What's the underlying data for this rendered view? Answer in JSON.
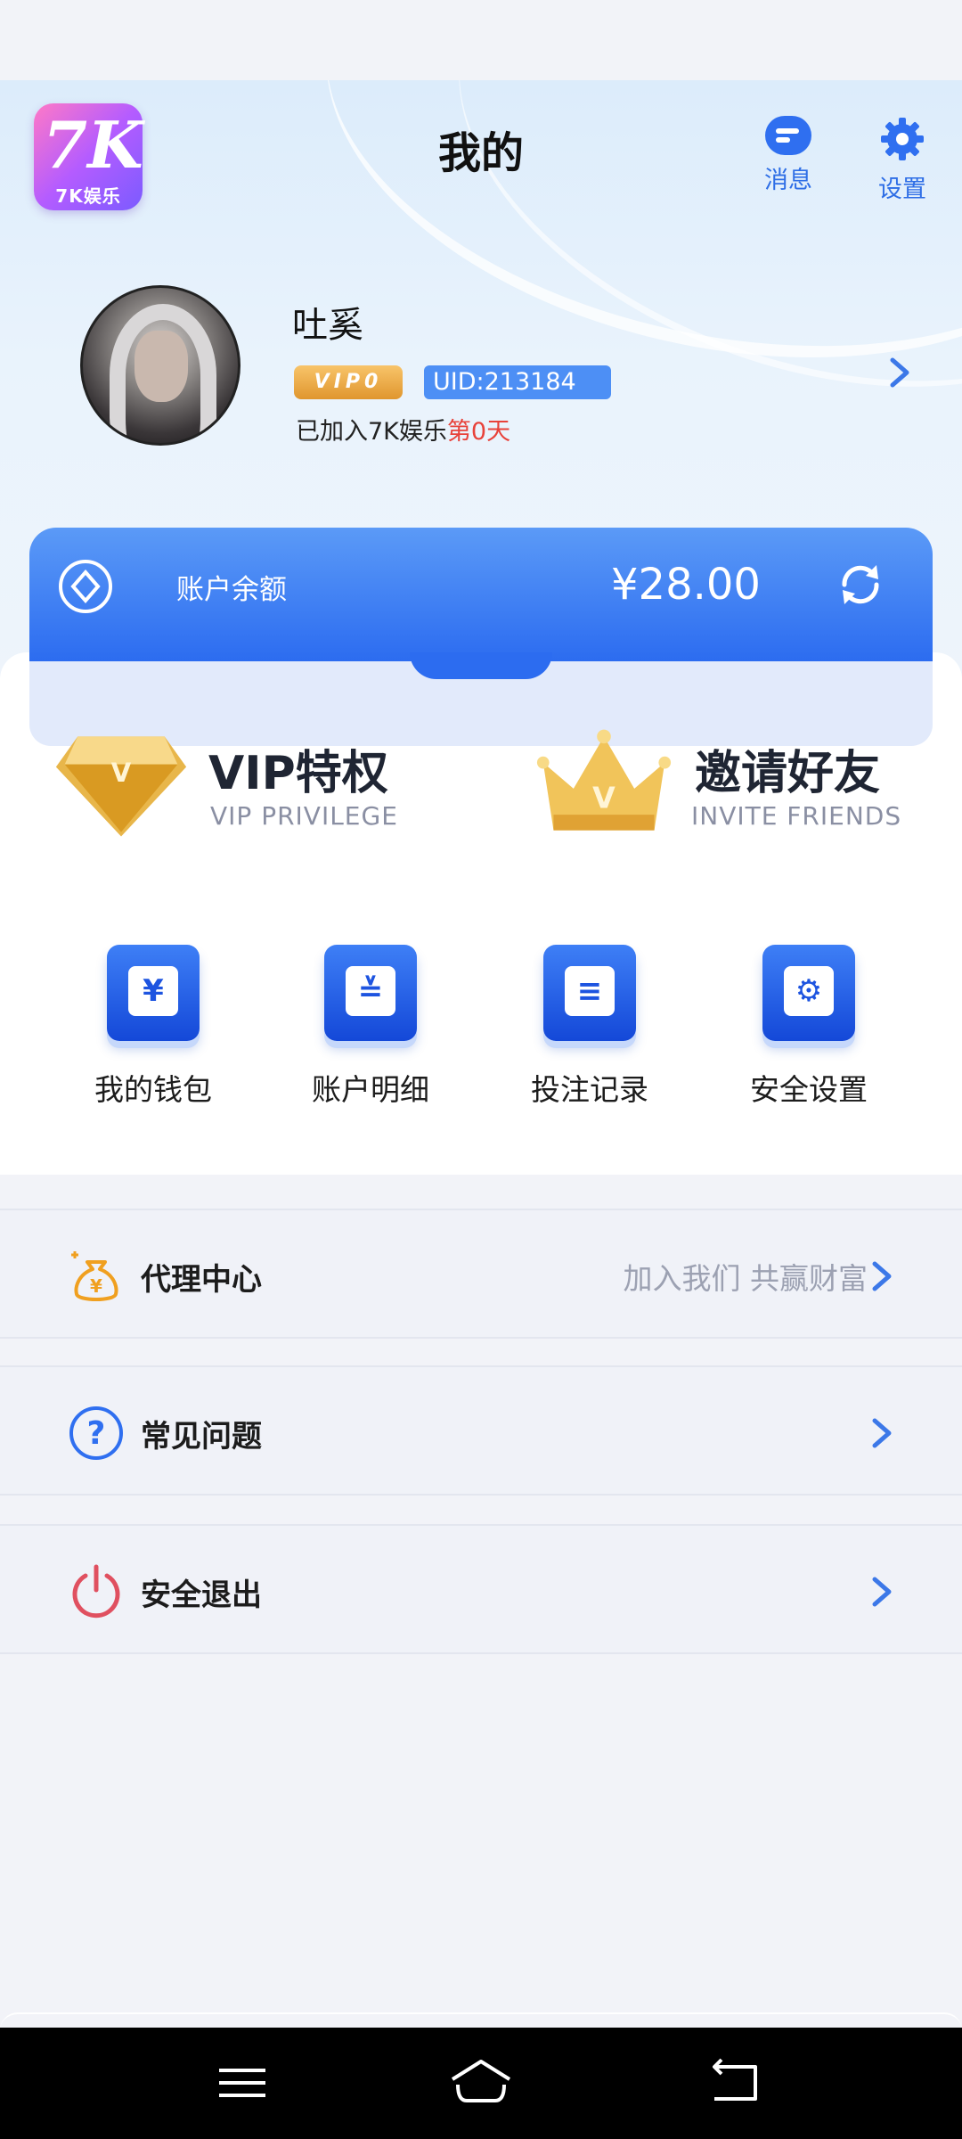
{
  "app": {
    "logo_text": "7K",
    "logo_subtext": "7K娱乐"
  },
  "header": {
    "title": "我的",
    "actions": [
      {
        "label": "消息",
        "icon": "message-icon"
      },
      {
        "label": "设置",
        "icon": "gear-icon"
      }
    ]
  },
  "profile": {
    "name": "吐奚",
    "vip_badge": "VIP0",
    "uid": "UID:213184",
    "join_prefix": "已加入7K娱乐",
    "join_days": "第0天"
  },
  "balance": {
    "label": "账户余额",
    "amount": "¥28.00"
  },
  "promos": [
    {
      "title": "VIP特权",
      "subtitle": "VIP PRIVILEGE",
      "icon": "diamond-v-icon"
    },
    {
      "title": "邀请好友",
      "subtitle": "INVITE FRIENDS",
      "icon": "crown-icon"
    }
  ],
  "quick_actions": [
    {
      "label": "我的钱包",
      "icon": "wallet-icon",
      "glyph": "¥"
    },
    {
      "label": "账户明细",
      "icon": "ledger-icon",
      "glyph": "≚"
    },
    {
      "label": "投注记录",
      "icon": "bet-record-icon",
      "glyph": "≡"
    },
    {
      "label": "安全设置",
      "icon": "shield-gear-icon",
      "glyph": "⚙"
    }
  ],
  "menu": [
    {
      "label": "代理中心",
      "hint": "加入我们  共赢财富",
      "icon": "money-bag-icon"
    },
    {
      "label": "常见问题",
      "hint": "",
      "icon": "question-icon"
    },
    {
      "label": "安全退出",
      "hint": "",
      "icon": "power-icon"
    }
  ],
  "colors": {
    "primary_blue": "#2c6cf0",
    "accent_red": "#e8423a",
    "gold": "#e0962e",
    "background": "#f2f3f8"
  }
}
